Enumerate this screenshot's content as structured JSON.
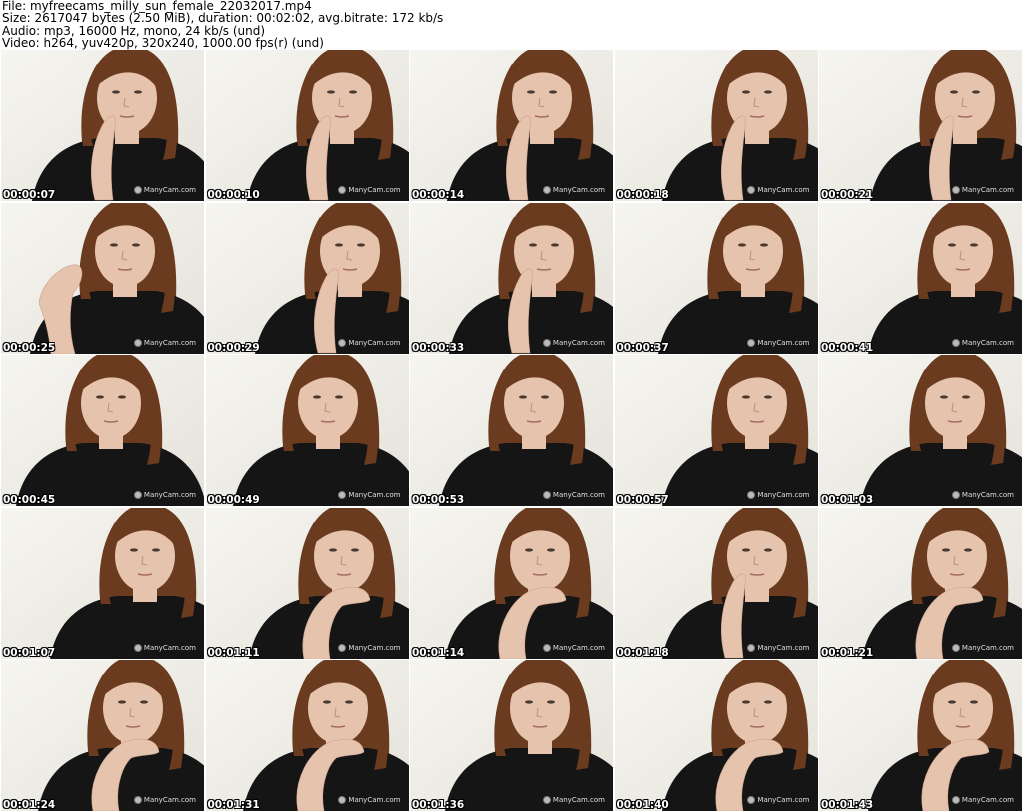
{
  "header": {
    "file_line": "File: myfreecams_milly_sun_female_22032017.mp4",
    "size_line": "Size: 2617047 bytes (2.50 MiB), duration: 00:02:02, avg.bitrate: 172 kb/s",
    "audio_line": "Audio: mp3, 16000 Hz, mono, 24 kb/s (und)",
    "video_line": "Video: h264, yuv420p, 320x240, 1000.00 fps(r) (und)"
  },
  "watermark": {
    "text": "ManyCam.com",
    "icon": "manycam-logo-icon"
  },
  "colors": {
    "background": "#f2f1ec",
    "hair": "#6b3b1f",
    "skin": "#e6c3ad",
    "shirt": "#151515"
  },
  "frames": [
    {
      "timestamp": "00:00:07"
    },
    {
      "timestamp": "00:00:10"
    },
    {
      "timestamp": "00:00:14"
    },
    {
      "timestamp": "00:00:18"
    },
    {
      "timestamp": "00:00:21"
    },
    {
      "timestamp": "00:00:25"
    },
    {
      "timestamp": "00:00:29"
    },
    {
      "timestamp": "00:00:33"
    },
    {
      "timestamp": "00:00:37"
    },
    {
      "timestamp": "00:00:41"
    },
    {
      "timestamp": "00:00:45"
    },
    {
      "timestamp": "00:00:49"
    },
    {
      "timestamp": "00:00:53"
    },
    {
      "timestamp": "00:00:57"
    },
    {
      "timestamp": "00:01:03"
    },
    {
      "timestamp": "00:01:07"
    },
    {
      "timestamp": "00:01:11"
    },
    {
      "timestamp": "00:01:14"
    },
    {
      "timestamp": "00:01:18"
    },
    {
      "timestamp": "00:01:21"
    },
    {
      "timestamp": "00:01:24"
    },
    {
      "timestamp": "00:01:31"
    },
    {
      "timestamp": "00:01:36"
    },
    {
      "timestamp": "00:01:40"
    },
    {
      "timestamp": "00:01:43"
    }
  ]
}
